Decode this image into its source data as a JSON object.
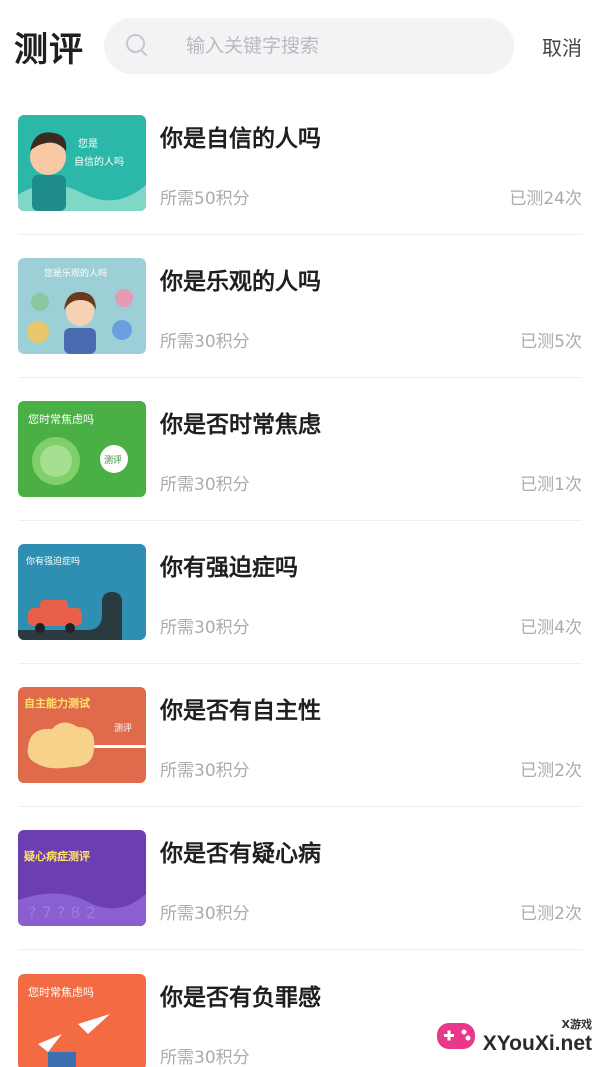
{
  "header": {
    "title": "测评",
    "search_placeholder": "输入关键字搜索",
    "search_value": "",
    "cancel_label": "取消"
  },
  "items": [
    {
      "title": "你是自信的人吗",
      "cost": "所需50积分",
      "count": "已测24次",
      "thumb_text": [
        "您是",
        "自信的人吗"
      ],
      "thumb_color": "#2bb8a8"
    },
    {
      "title": "你是乐观的人吗",
      "cost": "所需30积分",
      "count": "已测5次",
      "thumb_text": [
        "您是乐观的人吗"
      ],
      "thumb_color": "#9cd0d6"
    },
    {
      "title": "你是否时常焦虑",
      "cost": "所需30积分",
      "count": "已测1次",
      "thumb_text": [
        "您时常焦虑吗",
        "测评"
      ],
      "thumb_color": "#4ab046"
    },
    {
      "title": "你有强迫症吗",
      "cost": "所需30积分",
      "count": "已测4次",
      "thumb_text": [
        "你有强迫症吗"
      ],
      "thumb_color": "#2f8fb3"
    },
    {
      "title": "你是否有自主性",
      "cost": "所需30积分",
      "count": "已测2次",
      "thumb_text": [
        "自主能力测试",
        "测评"
      ],
      "thumb_color": "#e06a4c"
    },
    {
      "title": "你是否有疑心病",
      "cost": "所需30积分",
      "count": "已测2次",
      "thumb_text": [
        "疑心病症测评"
      ],
      "thumb_color": "#6b3fb0"
    },
    {
      "title": "你是否有负罪感",
      "cost": "所需30积分",
      "count": "",
      "thumb_text": [
        "您时常焦虑吗"
      ],
      "thumb_color": "#f26b43"
    }
  ],
  "watermark": {
    "small": "X游戏",
    "big": "XYouXi.net"
  }
}
